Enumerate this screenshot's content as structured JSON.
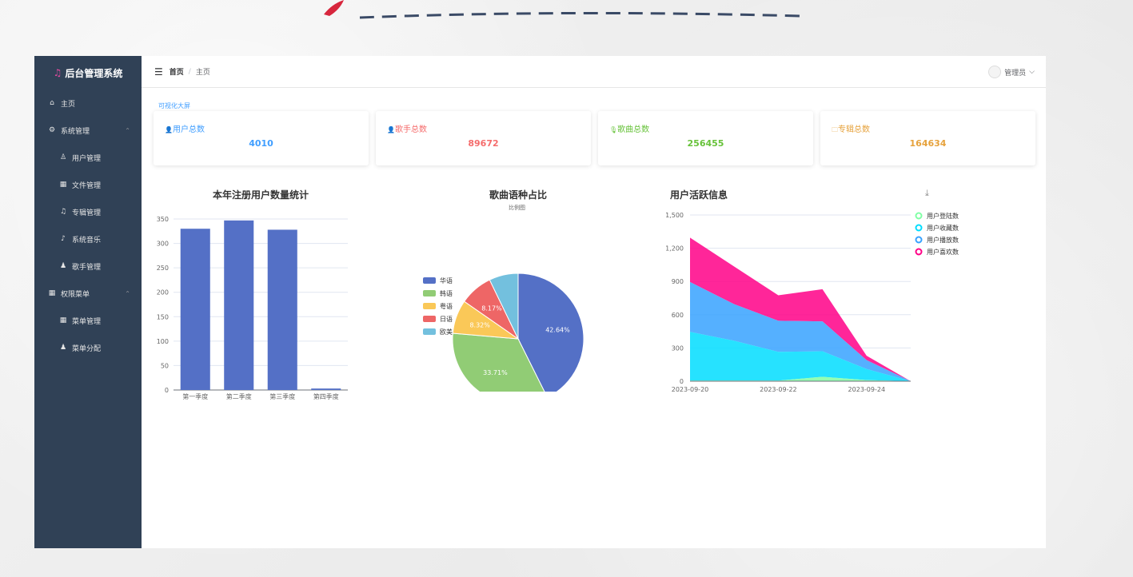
{
  "app": {
    "title": "后台管理系统"
  },
  "sidebar": {
    "items": [
      {
        "label": "主页",
        "level": 1,
        "icon": "home-icon"
      },
      {
        "label": "系统管理",
        "level": 1,
        "icon": "gear-icon",
        "expandable": true
      },
      {
        "label": "用户管理",
        "level": 2,
        "icon": "user-icon"
      },
      {
        "label": "文件管理",
        "level": 2,
        "icon": "grid-icon"
      },
      {
        "label": "专辑管理",
        "level": 2,
        "icon": "microphone-icon"
      },
      {
        "label": "系统音乐",
        "level": 2,
        "icon": "headphones-icon"
      },
      {
        "label": "歌手管理",
        "level": 2,
        "icon": "user-filled-icon"
      },
      {
        "label": "权限菜单",
        "level": 1,
        "icon": "grid-icon",
        "expandable": true
      },
      {
        "label": "菜单管理",
        "level": 2,
        "icon": "grid-icon"
      },
      {
        "label": "菜单分配",
        "level": 2,
        "icon": "user-filled-icon"
      }
    ]
  },
  "header": {
    "home": "首页",
    "separator": "/",
    "current": "主页",
    "user": "管理员"
  },
  "dashboard_link": "可视化大屏",
  "cards": [
    {
      "title": "用户总数",
      "value": "4010",
      "color": "#409eff",
      "icon": "👤"
    },
    {
      "title": "歌手总数",
      "value": "89672",
      "color": "#f56c6c",
      "icon": "👤"
    },
    {
      "title": "歌曲总数",
      "value": "256455",
      "color": "#67c23a",
      "icon": "🎙"
    },
    {
      "title": "专辑总数",
      "value": "164634",
      "color": "#e6a23c",
      "icon": "🗀"
    }
  ],
  "chart_data": [
    {
      "type": "bar",
      "title": "本年注册用户数量统计",
      "categories": [
        "第一季度",
        "第二季度",
        "第三季度",
        "第四季度"
      ],
      "values": [
        330,
        347,
        328,
        3
      ],
      "ylim": [
        0,
        350
      ],
      "yticks": [
        0,
        50,
        100,
        150,
        200,
        250,
        300,
        350
      ],
      "color": "#5470c6"
    },
    {
      "type": "pie",
      "title": "歌曲语种占比",
      "subtitle": "比例图",
      "legend": [
        "华语",
        "韩语",
        "粤语",
        "日语",
        "欧美"
      ],
      "values": [
        42.64,
        33.71,
        8.32,
        8.17,
        7.16
      ],
      "labels": [
        "42.64%",
        "33.71%",
        "8.32%",
        "8.17%",
        ""
      ],
      "colors": [
        "#5470c6",
        "#91cc75",
        "#fac858",
        "#ee6666",
        "#73c0de"
      ]
    },
    {
      "type": "area",
      "title": "用户活跃信息",
      "x": [
        "2023-09-20",
        "2023-09-21",
        "2023-09-22",
        "2023-09-23",
        "2023-09-24",
        "2023-09-25"
      ],
      "xticks": [
        "2023-09-20",
        "2023-09-22",
        "2023-09-24"
      ],
      "ylim": [
        0,
        1500
      ],
      "yticks": [
        "0",
        "300",
        "600",
        "900",
        "1,200",
        "1,500"
      ],
      "series": [
        {
          "name": "用户登陆数",
          "values": [
            5,
            5,
            5,
            40,
            10,
            0
          ],
          "color": "#80ffa5"
        },
        {
          "name": "用户收藏数",
          "values": [
            440,
            360,
            260,
            230,
            100,
            0
          ],
          "color": "#00ddff"
        },
        {
          "name": "用户播放数",
          "values": [
            450,
            330,
            280,
            270,
            80,
            0
          ],
          "color": "#37a2ff"
        },
        {
          "name": "用户喜欢数",
          "values": [
            400,
            340,
            230,
            290,
            40,
            0
          ],
          "color": "#ff0087"
        }
      ]
    }
  ]
}
